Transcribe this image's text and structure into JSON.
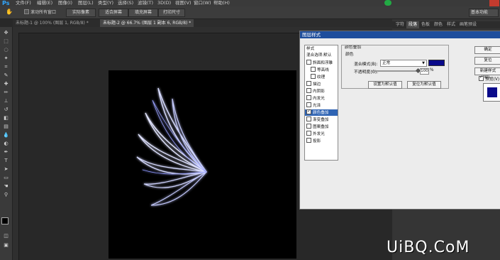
{
  "menubar": {
    "logo": "Ps",
    "items": [
      "文件(F)",
      "编辑(E)",
      "图像(I)",
      "图层(L)",
      "类型(Y)",
      "选择(S)",
      "滤镜(T)",
      "3D(D)",
      "视图(V)",
      "窗口(W)",
      "帮助(H)"
    ]
  },
  "options": {
    "checkbox_label": "滚动所有窗口",
    "btn1": "实际像素",
    "btn2": "适合屏幕",
    "btn3": "填充屏幕",
    "btn4": "打印尺寸",
    "workspace": "基本功能"
  },
  "tabs": [
    {
      "label": "未标题-1 @ 100% (图层 1, RGB/8) *",
      "active": false
    },
    {
      "label": "未标题-2 @ 66.7% (图层 1 副本 6, RGB/8) *",
      "active": true
    }
  ],
  "panel_tabs": [
    "字符",
    "段落",
    "色板",
    "颜色",
    "样式",
    "画笔预设"
  ],
  "dialog": {
    "title": "图层样式",
    "styles_header": "样式",
    "blend_options": "混合选项:默认",
    "effects": [
      {
        "label": "斜面和浮雕",
        "checked": false,
        "selected": false
      },
      {
        "label": "等高线",
        "checked": false,
        "selected": false
      },
      {
        "label": "纹理",
        "checked": false,
        "selected": false
      },
      {
        "label": "描边",
        "checked": false,
        "selected": false
      },
      {
        "label": "内阴影",
        "checked": false,
        "selected": false
      },
      {
        "label": "内发光",
        "checked": false,
        "selected": false
      },
      {
        "label": "光泽",
        "checked": false,
        "selected": false
      },
      {
        "label": "颜色叠加",
        "checked": true,
        "selected": true
      },
      {
        "label": "渐变叠加",
        "checked": false,
        "selected": false
      },
      {
        "label": "图案叠加",
        "checked": false,
        "selected": false
      },
      {
        "label": "外发光",
        "checked": false,
        "selected": false
      },
      {
        "label": "投影",
        "checked": false,
        "selected": false
      }
    ],
    "section_title": "颜色叠加",
    "group_title": "颜色",
    "blend_mode_label": "混合模式(B):",
    "blend_mode_value": "正常",
    "opacity_label": "不透明度(O):",
    "opacity_value": "100",
    "opacity_unit": "%",
    "opacity_fraction": 1.0,
    "overlay_color": "#0a0a8a",
    "make_default": "设置为默认值",
    "reset_default": "复位为默认值",
    "ok": "确定",
    "cancel": "复位",
    "new_style": "新建样式(W)...",
    "preview_label": "预览(V)",
    "preview_checked": true
  },
  "watermark": "UiBQ.CoM"
}
